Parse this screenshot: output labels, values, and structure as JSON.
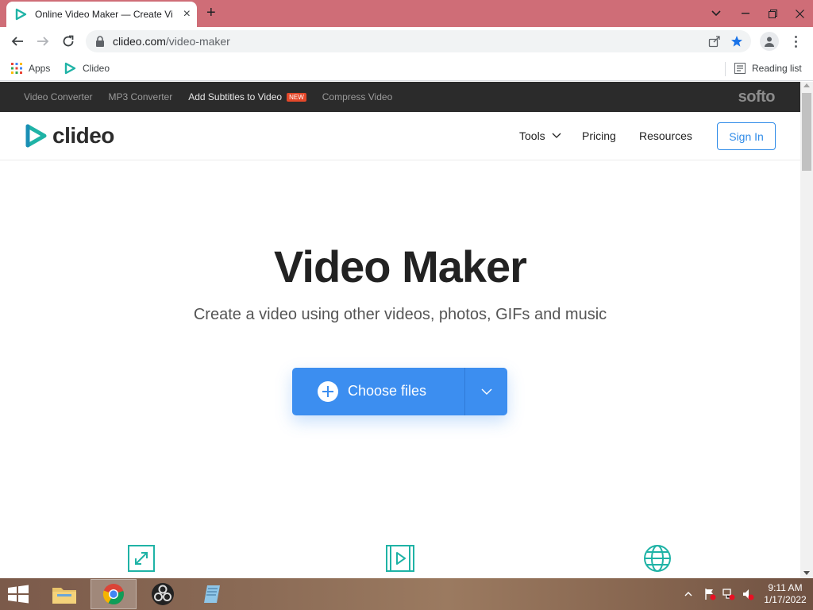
{
  "browser": {
    "tab_title": "Online Video Maker — Create Vi",
    "url_host": "clideo.com",
    "url_path": "/video-maker",
    "bookmarks": [
      {
        "label": "Apps",
        "icon": "apps-grid-icon"
      },
      {
        "label": "Clideo",
        "icon": "clideo-favicon"
      }
    ],
    "reading_list_label": "Reading list"
  },
  "promo_bar": {
    "links": [
      "Video Converter",
      "MP3 Converter",
      "Add Subtitles to Video",
      "Compress Video"
    ],
    "new_badge": "NEW",
    "brand": "softo"
  },
  "site_header": {
    "logo_text": "clideo",
    "nav": {
      "tools": "Tools",
      "pricing": "Pricing",
      "resources": "Resources"
    },
    "sign_in": "Sign In"
  },
  "hero": {
    "title": "Video Maker",
    "subtitle": "Create a video using other videos, photos, GIFs and music",
    "choose_files": "Choose files"
  },
  "features": {
    "icons": [
      "resize-icon",
      "video-play-icon",
      "globe-icon"
    ]
  },
  "taskbar": {
    "time": "9:11 AM",
    "date": "1/17/2022"
  },
  "colors": {
    "tabstrip": "#cf6d77",
    "accent_blue": "#3c8ef0",
    "teal": "#1fb3a6",
    "dark_bar": "#2b2b2b"
  }
}
